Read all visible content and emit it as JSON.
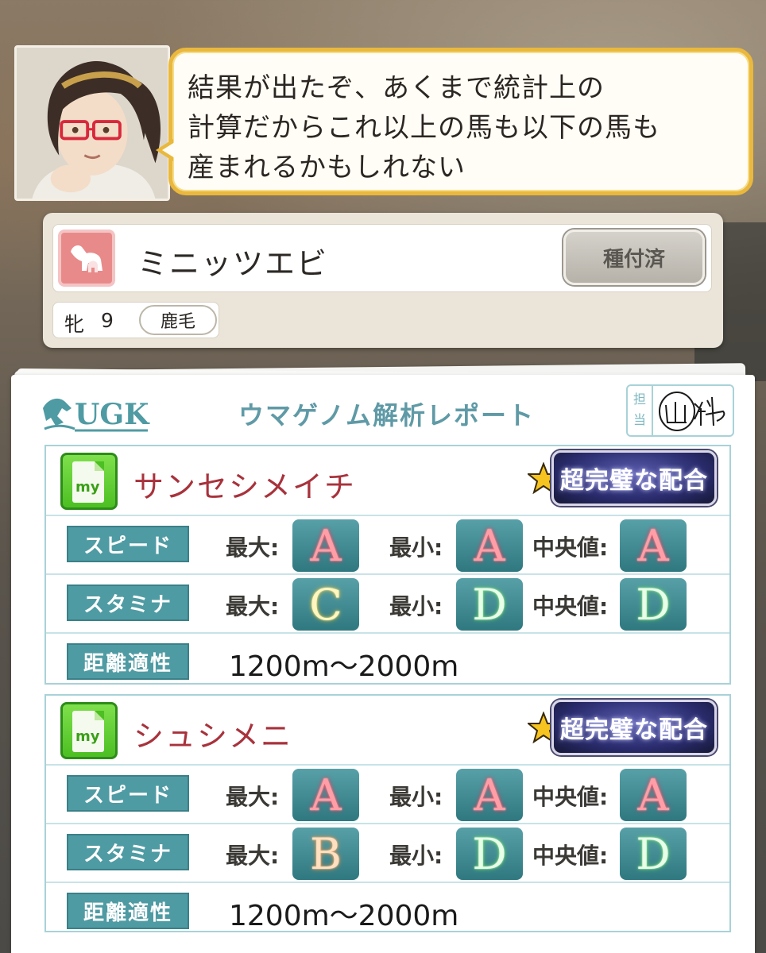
{
  "dialogue": {
    "lines": [
      "結果が出たぞ、あくまで統計上の",
      "計算だからこれ以上の馬も以下の馬も",
      "産まれるかもしれない"
    ]
  },
  "horse": {
    "name": "ミニッツエビ",
    "status_label": "種付済",
    "sex": "牝",
    "age": "9",
    "coat": "鹿毛"
  },
  "report": {
    "logo_text": "UGK",
    "title": "ウマゲノム解析レポート",
    "stamp_label_1": "担",
    "stamp_label_2": "当",
    "stamp_signature": "山科"
  },
  "labels": {
    "my": "my",
    "speed": "スピード",
    "stamina": "スタミナ",
    "distance": "距離適性",
    "max": "最大:",
    "min": "最小:",
    "median": "中央値:"
  },
  "entries": [
    {
      "sire": "サンセシメイチ",
      "stars": "5",
      "rank": "超完璧な配合",
      "speed": {
        "max": "A",
        "min": "A",
        "median": "A"
      },
      "stamina": {
        "max": "C",
        "min": "D",
        "median": "D"
      },
      "distance": "1200m〜2000m"
    },
    {
      "sire": "シュシメニ",
      "stars": "5",
      "rank": "超完璧な配合",
      "speed": {
        "max": "A",
        "min": "A",
        "median": "A"
      },
      "stamina": {
        "max": "B",
        "min": "D",
        "median": "D"
      },
      "distance": "1200m〜2000m"
    }
  ],
  "colors": {
    "bubble_border": "#e9b83c",
    "sire_name": "#a8323c",
    "stat_label_bg": "#4f9ba3",
    "grade_bg": "#2f7880",
    "star": "#f5c420"
  },
  "icons": [
    "trainer-portrait",
    "mare-icon",
    "ugk-horse-logo-icon",
    "my-document-icon",
    "star-icon"
  ]
}
